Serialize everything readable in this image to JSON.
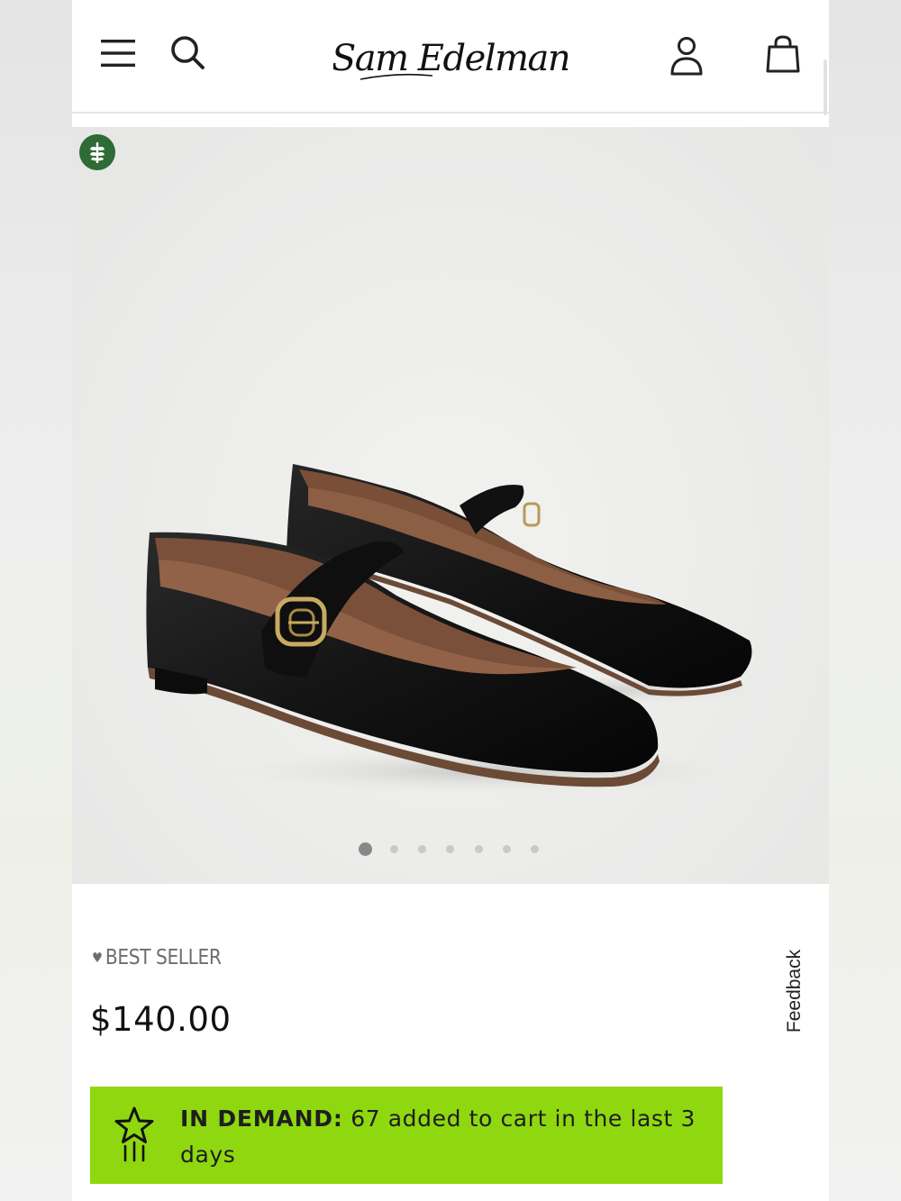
{
  "header": {
    "brand": "Sam Edelman",
    "menu_icon": "hamburger-menu-icon",
    "search_icon": "search-icon",
    "account_icon": "account-icon",
    "cart_icon": "shopping-bag-icon"
  },
  "product": {
    "image_alt": "Black leather Mary Jane flats with gold buckle",
    "eco_badge_icon": "leaf-icon",
    "carousel": {
      "total": 7,
      "active_index": 0
    },
    "badge_text": "BEST SELLER",
    "badge_icon": "heart-icon",
    "price": "$140.00"
  },
  "feedback": {
    "label": "Feedback"
  },
  "demand_banner": {
    "icon": "shooting-star-icon",
    "label": "IN DEMAND:",
    "message": " 67 added to cart in the last 3 days",
    "color": "#8fd810"
  }
}
